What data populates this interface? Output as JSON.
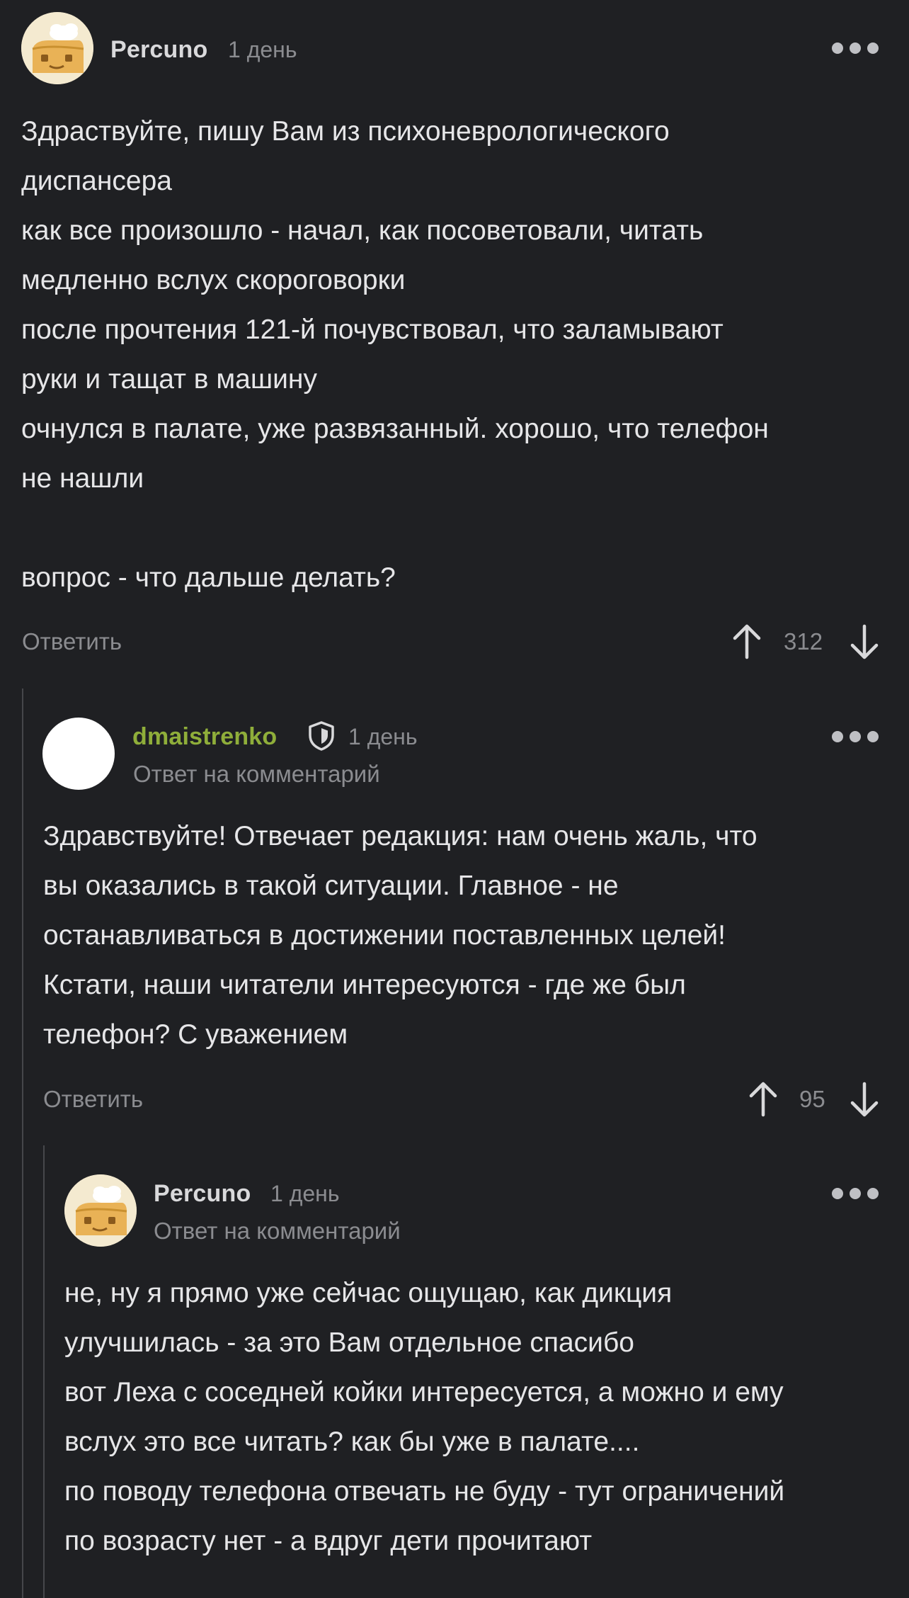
{
  "comments": [
    {
      "author": "Percuno",
      "time": "1 день",
      "text": "Здраствуйте, пишу Вам из психоневрологического\nдиспансера\nкак все произошло - начал, как посоветовали, читать\nмедленно вслух скороговорки\nпосле прочтения 121-й почувствовал, что заламывают\nруки и тащат в машину\nочнулся в палате, уже развязанный. хорошо, что телефон\nне нашли\n\nвопрос - что дальше делать?",
      "reply_label": "Ответить",
      "votes": "312",
      "avatar_icon": "pikabu-pie-avatar-icon"
    },
    {
      "author": "dmaistrenko",
      "author_color": "#8fae3a",
      "time": "1 день",
      "subtitle": "Ответ на комментарий",
      "text": "Здравствуйте! Отвечает редакция: нам очень жаль, что\nвы оказались в такой ситуации. Главное - не\nостанавливаться в достижении поставленных целей!\nКстати, наши читатели интересуются - где же был\nтелефон? С уважением",
      "reply_label": "Ответить",
      "votes": "95",
      "badge_icon": "shield-icon"
    },
    {
      "author": "Percuno",
      "time": "1 день",
      "subtitle": "Ответ на комментарий",
      "text": "не, ну я прямо уже сейчас ощущаю, как дикция\nулучшилась - за это Вам отдельное спасибо\nвот Леха с соседней койки интересуется, а можно и ему\nвслух это все читать? как бы уже в палате....\nпо поводу телефона отвечать не буду - тут ограничений\nпо возрасту нет - а вдруг дети прочитают",
      "avatar_icon": "pikabu-pie-avatar-icon"
    }
  ],
  "colors": {
    "background": "#1f2023",
    "text": "#e6e6e8",
    "muted": "#8b8c90",
    "moderator_green": "#8fae3a"
  }
}
